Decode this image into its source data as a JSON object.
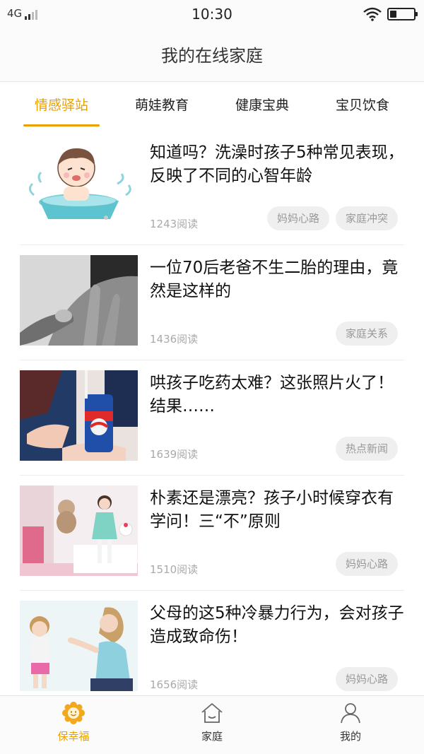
{
  "status_bar": {
    "network": "4G",
    "time": "10:30"
  },
  "header": {
    "title": "我的在线家庭"
  },
  "tabs": [
    {
      "label": "情感驿站",
      "active": true
    },
    {
      "label": "萌娃教育",
      "active": false
    },
    {
      "label": "健康宝典",
      "active": false
    },
    {
      "label": "宝贝饮食",
      "active": false
    }
  ],
  "articles": [
    {
      "title": "知道吗？洗澡时孩子5种常见表现，反映了不同的心智年龄",
      "reads": "1243阅读",
      "tags": [
        "妈妈心路",
        "家庭冲突"
      ],
      "image": "bath-cartoon"
    },
    {
      "title": "一位70后老爸不生二胎的理由，竟然是这样的",
      "reads": "1436阅读",
      "tags": [
        "家庭关系"
      ],
      "image": "hands-photo"
    },
    {
      "title": "哄孩子吃药太难？这张照片火了！结果……",
      "reads": "1639阅读",
      "tags": [
        "热点新闻"
      ],
      "image": "child-cola-photo"
    },
    {
      "title": "朴素还是漂亮？孩子小时候穿衣有学问！三“不”原则",
      "reads": "1510阅读",
      "tags": [
        "妈妈心路"
      ],
      "image": "girl-room-photo"
    },
    {
      "title": "父母的这5种冷暴力行为，会对孩子造成致命伤！",
      "reads": "1656阅读",
      "tags": [
        "妈妈心路"
      ],
      "image": "mother-child-photo"
    }
  ],
  "bottom_nav": [
    {
      "label": "保幸福",
      "icon": "sunflower-icon",
      "active": true
    },
    {
      "label": "家庭",
      "icon": "house-icon",
      "active": false
    },
    {
      "label": "我的",
      "icon": "person-icon",
      "active": false
    }
  ],
  "colors": {
    "accent": "#e8a100",
    "tag_bg": "#efefef",
    "muted_text": "#aaaaaa"
  }
}
